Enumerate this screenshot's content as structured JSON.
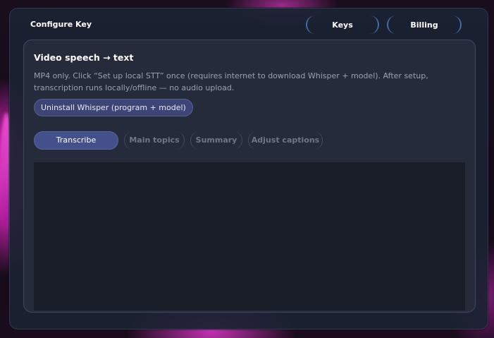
{
  "header": {
    "title": "Configure Key",
    "tabs": [
      {
        "label": "Keys"
      },
      {
        "label": "Billing"
      }
    ]
  },
  "panel": {
    "title": "Video speech → text",
    "description": "MP4 only. Click “Set up local STT” once (requires internet to download Whisper + model). After setup, transcription runs locally/offline — no audio upload.",
    "uninstall_label": "Uninstall Whisper (program + model)",
    "mode_tabs": [
      {
        "label": "Transcribe",
        "active": true
      },
      {
        "label": "Main topics",
        "active": false
      },
      {
        "label": "Summary",
        "active": false
      },
      {
        "label": "Adjust captions",
        "active": false
      }
    ],
    "output_text": ""
  },
  "colors": {
    "accent": "#43508a",
    "tab_border": "#3c6fb0",
    "panel_bg": "#252b3a",
    "output_bg": "#1a1e28"
  }
}
